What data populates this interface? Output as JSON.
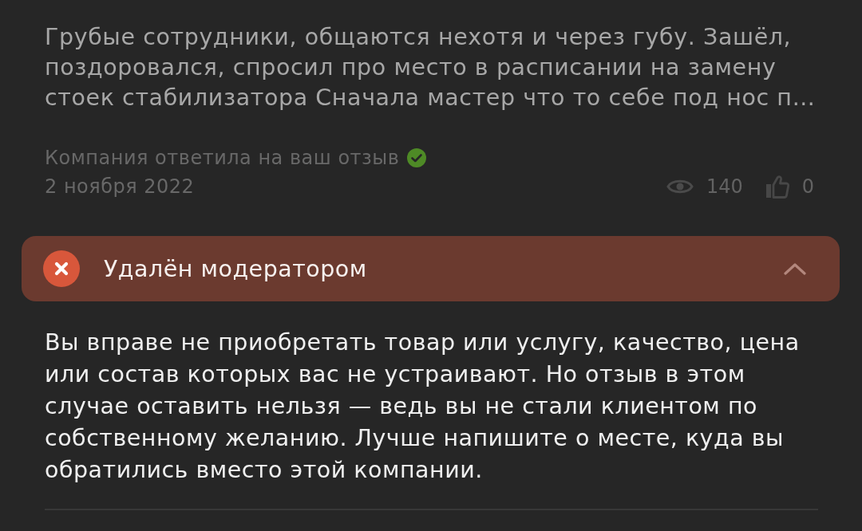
{
  "review": {
    "text": "Грубые сотрудники, общаются нехотя и через губу. Зашёл, поздоровался, спросил про место в расписании на замену стоек стабилизатора Сначала мастер что то себе под нос п…",
    "reply_status": "Компания ответила на ваш отзыв",
    "date": "2 ноября 2022",
    "views": "140",
    "likes": "0"
  },
  "moderation": {
    "title": "Удалён модератором",
    "expanded": true,
    "message": "Вы вправе не приобретать товар или услугу, качество, цена или состав которых вас не устраивают. Но отзыв в этом случае оставить нельзя — ведь вы не стали клиентом по собственному желанию. Лучше напишите о месте, куда вы обратились вместо этой компании."
  }
}
